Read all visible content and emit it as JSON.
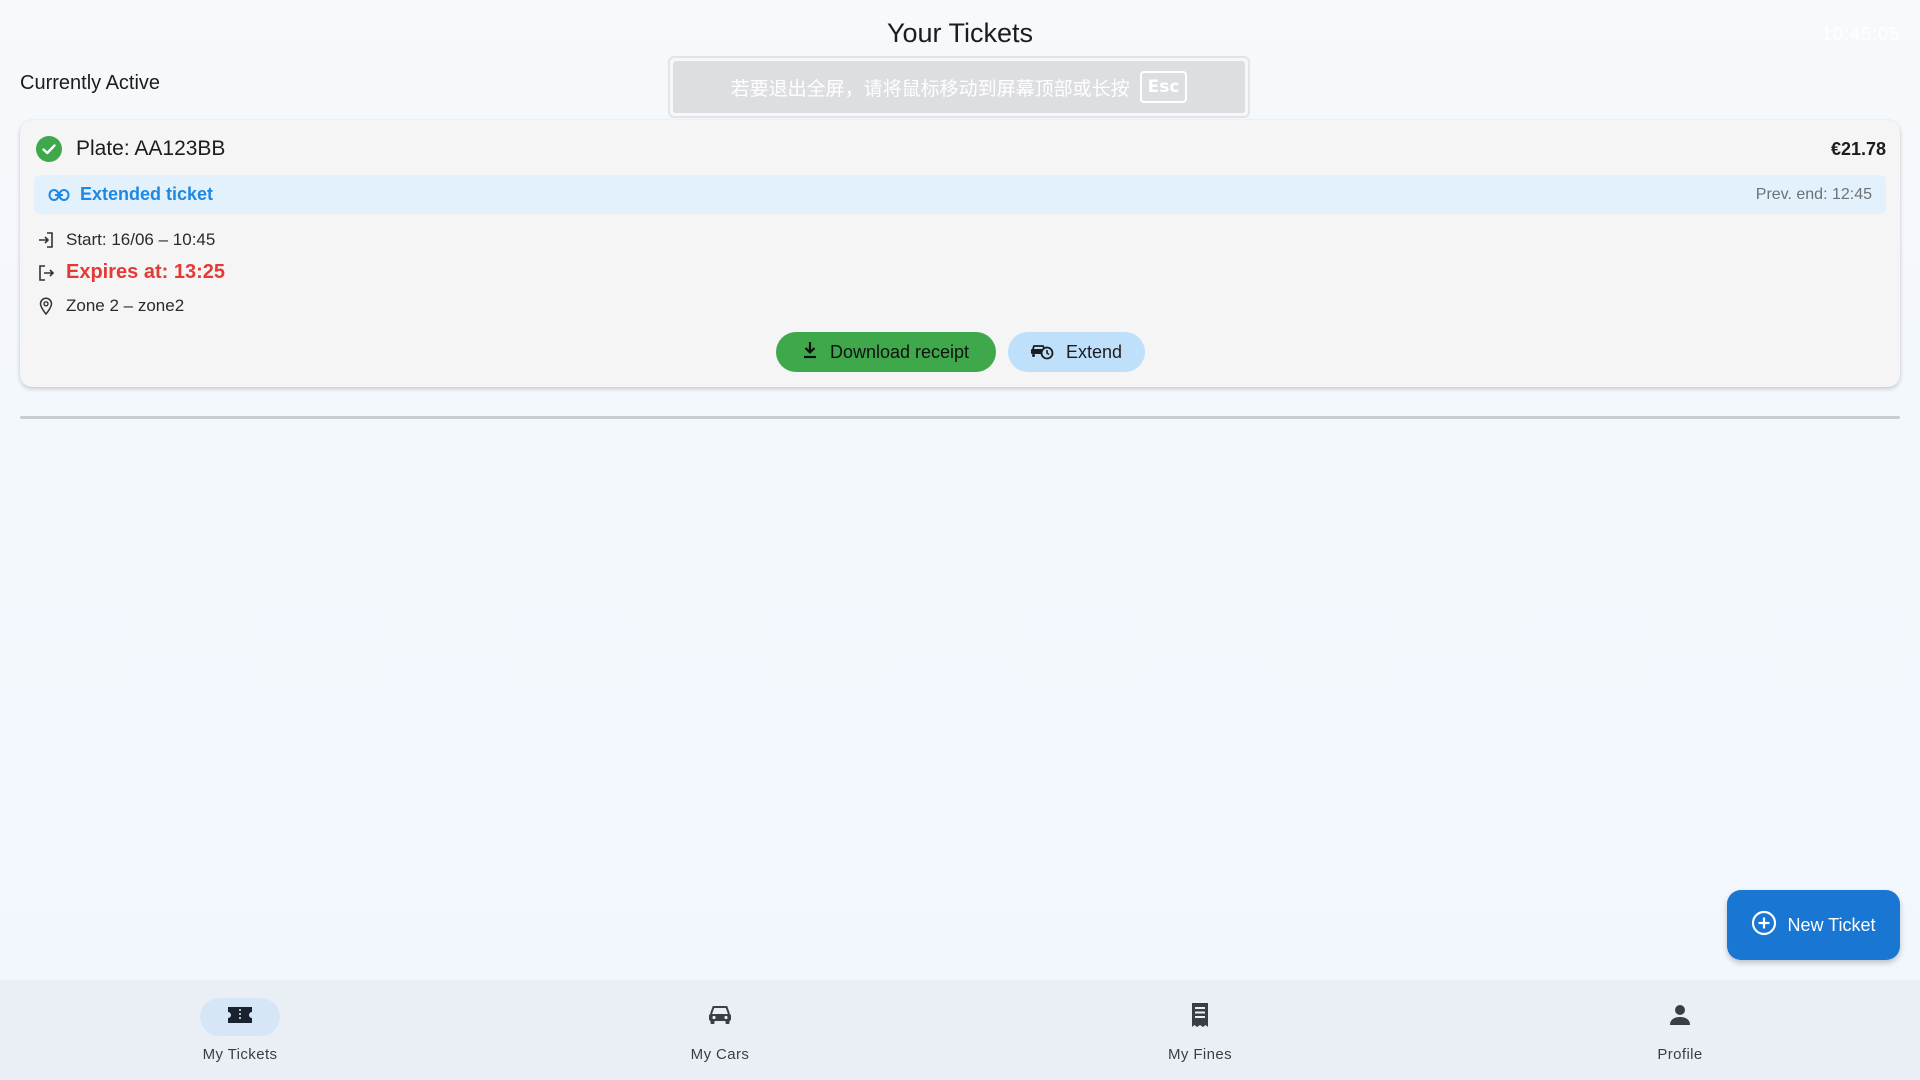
{
  "status_bar": {
    "clock": "10:45:05"
  },
  "header": {
    "title": "Your Tickets"
  },
  "fullscreen_notice": {
    "message": "若要退出全屏，请将鼠标移动到屏幕顶部或长按",
    "key": "Esc"
  },
  "section": {
    "title": "Currently Active"
  },
  "ticket": {
    "plate": "Plate: AA123BB",
    "price": "€21.78",
    "extended_label": "Extended ticket",
    "prev_end": "Prev. end: 12:45",
    "start": "Start: 16/06 – 10:45",
    "expires": "Expires at: 13:25",
    "zone": "Zone 2 – zone2",
    "download_label": "Download receipt",
    "extend_label": "Extend"
  },
  "fab": {
    "label": "New Ticket"
  },
  "nav": {
    "items": [
      {
        "label": "My Tickets",
        "icon": "ticket-icon",
        "active": true
      },
      {
        "label": "My Cars",
        "icon": "car-icon",
        "active": false
      },
      {
        "label": "My Fines",
        "icon": "receipt-icon",
        "active": false
      },
      {
        "label": "Profile",
        "icon": "person-icon",
        "active": false
      }
    ]
  },
  "colors": {
    "success_green": "#3fa84b",
    "link_blue": "#1e88e5",
    "expire_red": "#e53935",
    "primary_blue": "#1976d2",
    "extend_btn": "#bfe0fb"
  }
}
